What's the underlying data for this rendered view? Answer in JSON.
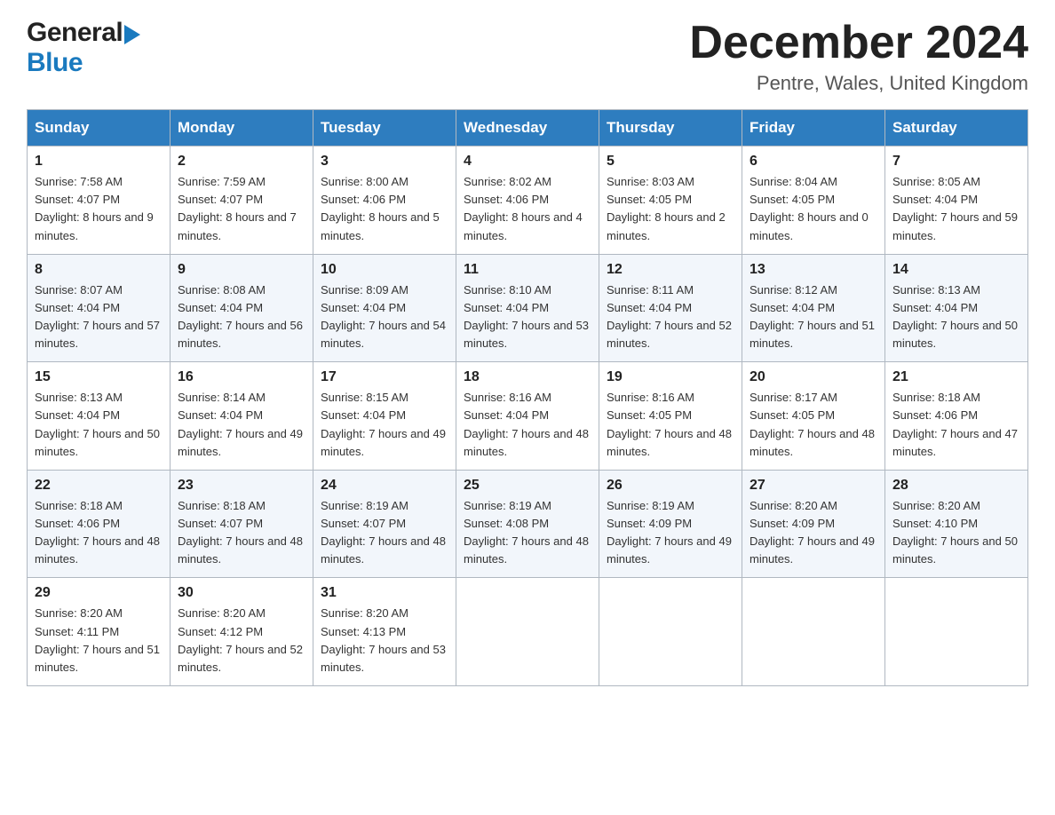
{
  "header": {
    "logo_general": "General",
    "logo_blue": "Blue",
    "month_title": "December 2024",
    "location": "Pentre, Wales, United Kingdom"
  },
  "days_of_week": [
    "Sunday",
    "Monday",
    "Tuesday",
    "Wednesday",
    "Thursday",
    "Friday",
    "Saturday"
  ],
  "weeks": [
    [
      {
        "day": "1",
        "sunrise": "7:58 AM",
        "sunset": "4:07 PM",
        "daylight": "8 hours and 9 minutes."
      },
      {
        "day": "2",
        "sunrise": "7:59 AM",
        "sunset": "4:07 PM",
        "daylight": "8 hours and 7 minutes."
      },
      {
        "day": "3",
        "sunrise": "8:00 AM",
        "sunset": "4:06 PM",
        "daylight": "8 hours and 5 minutes."
      },
      {
        "day": "4",
        "sunrise": "8:02 AM",
        "sunset": "4:06 PM",
        "daylight": "8 hours and 4 minutes."
      },
      {
        "day": "5",
        "sunrise": "8:03 AM",
        "sunset": "4:05 PM",
        "daylight": "8 hours and 2 minutes."
      },
      {
        "day": "6",
        "sunrise": "8:04 AM",
        "sunset": "4:05 PM",
        "daylight": "8 hours and 0 minutes."
      },
      {
        "day": "7",
        "sunrise": "8:05 AM",
        "sunset": "4:04 PM",
        "daylight": "7 hours and 59 minutes."
      }
    ],
    [
      {
        "day": "8",
        "sunrise": "8:07 AM",
        "sunset": "4:04 PM",
        "daylight": "7 hours and 57 minutes."
      },
      {
        "day": "9",
        "sunrise": "8:08 AM",
        "sunset": "4:04 PM",
        "daylight": "7 hours and 56 minutes."
      },
      {
        "day": "10",
        "sunrise": "8:09 AM",
        "sunset": "4:04 PM",
        "daylight": "7 hours and 54 minutes."
      },
      {
        "day": "11",
        "sunrise": "8:10 AM",
        "sunset": "4:04 PM",
        "daylight": "7 hours and 53 minutes."
      },
      {
        "day": "12",
        "sunrise": "8:11 AM",
        "sunset": "4:04 PM",
        "daylight": "7 hours and 52 minutes."
      },
      {
        "day": "13",
        "sunrise": "8:12 AM",
        "sunset": "4:04 PM",
        "daylight": "7 hours and 51 minutes."
      },
      {
        "day": "14",
        "sunrise": "8:13 AM",
        "sunset": "4:04 PM",
        "daylight": "7 hours and 50 minutes."
      }
    ],
    [
      {
        "day": "15",
        "sunrise": "8:13 AM",
        "sunset": "4:04 PM",
        "daylight": "7 hours and 50 minutes."
      },
      {
        "day": "16",
        "sunrise": "8:14 AM",
        "sunset": "4:04 PM",
        "daylight": "7 hours and 49 minutes."
      },
      {
        "day": "17",
        "sunrise": "8:15 AM",
        "sunset": "4:04 PM",
        "daylight": "7 hours and 49 minutes."
      },
      {
        "day": "18",
        "sunrise": "8:16 AM",
        "sunset": "4:04 PM",
        "daylight": "7 hours and 48 minutes."
      },
      {
        "day": "19",
        "sunrise": "8:16 AM",
        "sunset": "4:05 PM",
        "daylight": "7 hours and 48 minutes."
      },
      {
        "day": "20",
        "sunrise": "8:17 AM",
        "sunset": "4:05 PM",
        "daylight": "7 hours and 48 minutes."
      },
      {
        "day": "21",
        "sunrise": "8:18 AM",
        "sunset": "4:06 PM",
        "daylight": "7 hours and 47 minutes."
      }
    ],
    [
      {
        "day": "22",
        "sunrise": "8:18 AM",
        "sunset": "4:06 PM",
        "daylight": "7 hours and 48 minutes."
      },
      {
        "day": "23",
        "sunrise": "8:18 AM",
        "sunset": "4:07 PM",
        "daylight": "7 hours and 48 minutes."
      },
      {
        "day": "24",
        "sunrise": "8:19 AM",
        "sunset": "4:07 PM",
        "daylight": "7 hours and 48 minutes."
      },
      {
        "day": "25",
        "sunrise": "8:19 AM",
        "sunset": "4:08 PM",
        "daylight": "7 hours and 48 minutes."
      },
      {
        "day": "26",
        "sunrise": "8:19 AM",
        "sunset": "4:09 PM",
        "daylight": "7 hours and 49 minutes."
      },
      {
        "day": "27",
        "sunrise": "8:20 AM",
        "sunset": "4:09 PM",
        "daylight": "7 hours and 49 minutes."
      },
      {
        "day": "28",
        "sunrise": "8:20 AM",
        "sunset": "4:10 PM",
        "daylight": "7 hours and 50 minutes."
      }
    ],
    [
      {
        "day": "29",
        "sunrise": "8:20 AM",
        "sunset": "4:11 PM",
        "daylight": "7 hours and 51 minutes."
      },
      {
        "day": "30",
        "sunrise": "8:20 AM",
        "sunset": "4:12 PM",
        "daylight": "7 hours and 52 minutes."
      },
      {
        "day": "31",
        "sunrise": "8:20 AM",
        "sunset": "4:13 PM",
        "daylight": "7 hours and 53 minutes."
      },
      null,
      null,
      null,
      null
    ]
  ],
  "labels": {
    "sunrise": "Sunrise: ",
    "sunset": "Sunset: ",
    "daylight": "Daylight: "
  }
}
